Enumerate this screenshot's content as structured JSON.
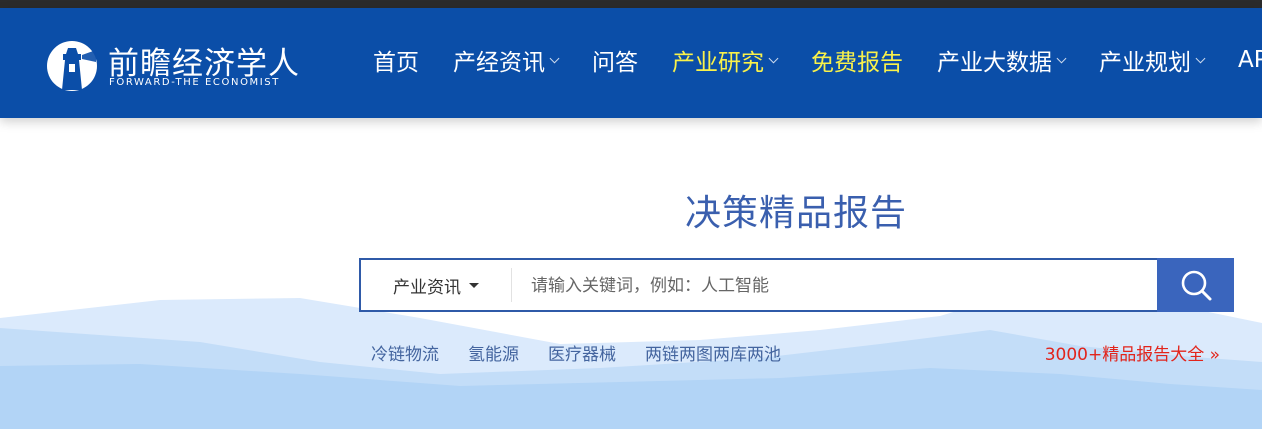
{
  "logo": {
    "name_cn": "前瞻经济学人",
    "name_en": "FORWARD-THE ECONOMIST",
    "icon": "lighthouse-logo-icon"
  },
  "nav": {
    "items": [
      {
        "label": "首页",
        "dropdown": false,
        "highlight": false
      },
      {
        "label": "产经资讯",
        "dropdown": true,
        "highlight": false
      },
      {
        "label": "问答",
        "dropdown": false,
        "highlight": false
      },
      {
        "label": "产业研究",
        "dropdown": true,
        "highlight": true
      },
      {
        "label": "免费报告",
        "dropdown": false,
        "highlight": true
      },
      {
        "label": "产业大数据",
        "dropdown": true,
        "highlight": false
      },
      {
        "label": "产业规划",
        "dropdown": true,
        "highlight": false
      },
      {
        "label": "AP",
        "dropdown": false,
        "highlight": false
      }
    ]
  },
  "hero": {
    "title": "决策精品报告"
  },
  "search": {
    "category": "产业资讯",
    "placeholder": "请输入关键词，例如：人工智能",
    "button_icon": "search-icon"
  },
  "tags": [
    "冷链物流",
    "氢能源",
    "医疗器械",
    "两链两图两库两池"
  ],
  "more_link": "3000+精品报告大全 »",
  "colors": {
    "header_bg": "#0b4ea8",
    "highlight": "#f9f14a",
    "title": "#3a5fae",
    "search_btn": "#3a65bd",
    "more_link": "#e2241b"
  }
}
